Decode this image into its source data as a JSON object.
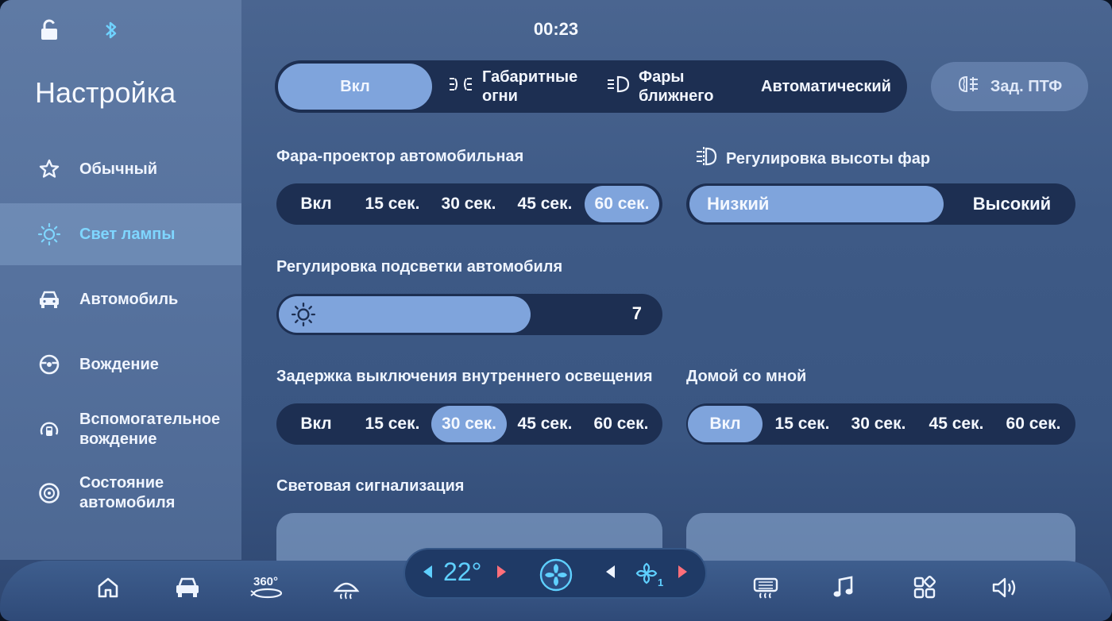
{
  "status": {
    "clock": "00:23"
  },
  "sidebar": {
    "title": "Настройка",
    "items": [
      {
        "label": "Обычный",
        "icon": "star-icon",
        "active": false
      },
      {
        "label": "Свет лампы",
        "icon": "sun-icon",
        "active": true
      },
      {
        "label": "Автомобиль",
        "icon": "car-icon",
        "active": false
      },
      {
        "label": "Вождение",
        "icon": "steering-wheel-icon",
        "active": false
      },
      {
        "label": "Вспомогательное вождение",
        "icon": "driver-assist-icon",
        "active": false
      },
      {
        "label": "Состояние автомобиля",
        "icon": "wheel-icon",
        "active": false
      }
    ]
  },
  "light_mode": {
    "options": [
      {
        "label": "Вкл",
        "selected": true
      },
      {
        "label": "Габаритные огни",
        "icon": "parking-lights-icon"
      },
      {
        "label": "Фары ближнего",
        "icon": "low-beam-icon"
      },
      {
        "label": "Автоматический"
      }
    ],
    "rear_fog": {
      "label": "Зад. ПТФ",
      "icon": "rear-fog-icon"
    }
  },
  "projector": {
    "label": "Фара-проектор автомобильная",
    "options": [
      "Вкл",
      "15 сек.",
      "30 сек.",
      "45 сек.",
      "60 сек."
    ],
    "selected_index": 4
  },
  "height": {
    "label": "Регулировка высоты фар",
    "icon": "headlight-level-icon",
    "options": [
      "Низкий",
      "Высокий"
    ],
    "selected_index": 0
  },
  "backlight": {
    "label": "Регулировка подсветки автомобиля",
    "value": "7",
    "level_fraction": 0.66
  },
  "interior_delay": {
    "label": "Задержка выключения внутреннего освещения",
    "options": [
      "Вкл",
      "15 сек.",
      "30 сек.",
      "45 сек.",
      "60 сек."
    ],
    "selected_index": 2
  },
  "follow_home": {
    "label": "Домой со мной",
    "options": [
      "Вкл",
      "15 сек.",
      "30 сек.",
      "45 сек.",
      "60 сек."
    ],
    "selected_index": 0
  },
  "signal": {
    "label": "Световая сигнализация"
  },
  "dock": {
    "temperature": "22°",
    "icons": [
      "home-icon",
      "car-icon",
      "360-view-icon",
      "front-defrost-icon",
      "fan-icon",
      "fan-speed-icon",
      "rear-defrost-icon",
      "music-icon",
      "apps-icon",
      "volume-icon"
    ],
    "view_360": "360°",
    "fan_level": "1"
  },
  "colors": {
    "accent": "#7fa4dc",
    "active_text": "#7fd6ff",
    "track": "#1d2f52",
    "temp": "#5fd0ff"
  }
}
